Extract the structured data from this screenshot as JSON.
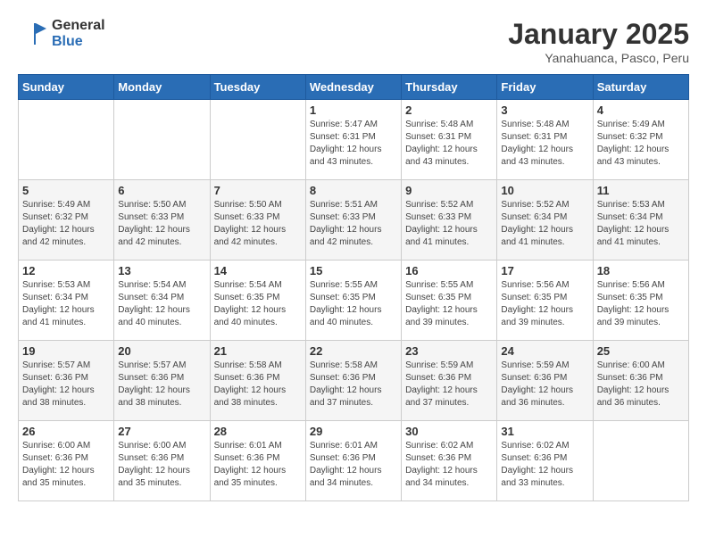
{
  "logo": {
    "general": "General",
    "blue": "Blue"
  },
  "header": {
    "title": "January 2025",
    "subtitle": "Yanahuanca, Pasco, Peru"
  },
  "weekdays": [
    "Sunday",
    "Monday",
    "Tuesday",
    "Wednesday",
    "Thursday",
    "Friday",
    "Saturday"
  ],
  "weeks": [
    [
      {
        "day": "",
        "sunrise": "",
        "sunset": "",
        "daylight": ""
      },
      {
        "day": "",
        "sunrise": "",
        "sunset": "",
        "daylight": ""
      },
      {
        "day": "",
        "sunrise": "",
        "sunset": "",
        "daylight": ""
      },
      {
        "day": "1",
        "sunrise": "Sunrise: 5:47 AM",
        "sunset": "Sunset: 6:31 PM",
        "daylight": "Daylight: 12 hours and 43 minutes."
      },
      {
        "day": "2",
        "sunrise": "Sunrise: 5:48 AM",
        "sunset": "Sunset: 6:31 PM",
        "daylight": "Daylight: 12 hours and 43 minutes."
      },
      {
        "day": "3",
        "sunrise": "Sunrise: 5:48 AM",
        "sunset": "Sunset: 6:31 PM",
        "daylight": "Daylight: 12 hours and 43 minutes."
      },
      {
        "day": "4",
        "sunrise": "Sunrise: 5:49 AM",
        "sunset": "Sunset: 6:32 PM",
        "daylight": "Daylight: 12 hours and 43 minutes."
      }
    ],
    [
      {
        "day": "5",
        "sunrise": "Sunrise: 5:49 AM",
        "sunset": "Sunset: 6:32 PM",
        "daylight": "Daylight: 12 hours and 42 minutes."
      },
      {
        "day": "6",
        "sunrise": "Sunrise: 5:50 AM",
        "sunset": "Sunset: 6:33 PM",
        "daylight": "Daylight: 12 hours and 42 minutes."
      },
      {
        "day": "7",
        "sunrise": "Sunrise: 5:50 AM",
        "sunset": "Sunset: 6:33 PM",
        "daylight": "Daylight: 12 hours and 42 minutes."
      },
      {
        "day": "8",
        "sunrise": "Sunrise: 5:51 AM",
        "sunset": "Sunset: 6:33 PM",
        "daylight": "Daylight: 12 hours and 42 minutes."
      },
      {
        "day": "9",
        "sunrise": "Sunrise: 5:52 AM",
        "sunset": "Sunset: 6:33 PM",
        "daylight": "Daylight: 12 hours and 41 minutes."
      },
      {
        "day": "10",
        "sunrise": "Sunrise: 5:52 AM",
        "sunset": "Sunset: 6:34 PM",
        "daylight": "Daylight: 12 hours and 41 minutes."
      },
      {
        "day": "11",
        "sunrise": "Sunrise: 5:53 AM",
        "sunset": "Sunset: 6:34 PM",
        "daylight": "Daylight: 12 hours and 41 minutes."
      }
    ],
    [
      {
        "day": "12",
        "sunrise": "Sunrise: 5:53 AM",
        "sunset": "Sunset: 6:34 PM",
        "daylight": "Daylight: 12 hours and 41 minutes."
      },
      {
        "day": "13",
        "sunrise": "Sunrise: 5:54 AM",
        "sunset": "Sunset: 6:34 PM",
        "daylight": "Daylight: 12 hours and 40 minutes."
      },
      {
        "day": "14",
        "sunrise": "Sunrise: 5:54 AM",
        "sunset": "Sunset: 6:35 PM",
        "daylight": "Daylight: 12 hours and 40 minutes."
      },
      {
        "day": "15",
        "sunrise": "Sunrise: 5:55 AM",
        "sunset": "Sunset: 6:35 PM",
        "daylight": "Daylight: 12 hours and 40 minutes."
      },
      {
        "day": "16",
        "sunrise": "Sunrise: 5:55 AM",
        "sunset": "Sunset: 6:35 PM",
        "daylight": "Daylight: 12 hours and 39 minutes."
      },
      {
        "day": "17",
        "sunrise": "Sunrise: 5:56 AM",
        "sunset": "Sunset: 6:35 PM",
        "daylight": "Daylight: 12 hours and 39 minutes."
      },
      {
        "day": "18",
        "sunrise": "Sunrise: 5:56 AM",
        "sunset": "Sunset: 6:35 PM",
        "daylight": "Daylight: 12 hours and 39 minutes."
      }
    ],
    [
      {
        "day": "19",
        "sunrise": "Sunrise: 5:57 AM",
        "sunset": "Sunset: 6:36 PM",
        "daylight": "Daylight: 12 hours and 38 minutes."
      },
      {
        "day": "20",
        "sunrise": "Sunrise: 5:57 AM",
        "sunset": "Sunset: 6:36 PM",
        "daylight": "Daylight: 12 hours and 38 minutes."
      },
      {
        "day": "21",
        "sunrise": "Sunrise: 5:58 AM",
        "sunset": "Sunset: 6:36 PM",
        "daylight": "Daylight: 12 hours and 38 minutes."
      },
      {
        "day": "22",
        "sunrise": "Sunrise: 5:58 AM",
        "sunset": "Sunset: 6:36 PM",
        "daylight": "Daylight: 12 hours and 37 minutes."
      },
      {
        "day": "23",
        "sunrise": "Sunrise: 5:59 AM",
        "sunset": "Sunset: 6:36 PM",
        "daylight": "Daylight: 12 hours and 37 minutes."
      },
      {
        "day": "24",
        "sunrise": "Sunrise: 5:59 AM",
        "sunset": "Sunset: 6:36 PM",
        "daylight": "Daylight: 12 hours and 36 minutes."
      },
      {
        "day": "25",
        "sunrise": "Sunrise: 6:00 AM",
        "sunset": "Sunset: 6:36 PM",
        "daylight": "Daylight: 12 hours and 36 minutes."
      }
    ],
    [
      {
        "day": "26",
        "sunrise": "Sunrise: 6:00 AM",
        "sunset": "Sunset: 6:36 PM",
        "daylight": "Daylight: 12 hours and 35 minutes."
      },
      {
        "day": "27",
        "sunrise": "Sunrise: 6:00 AM",
        "sunset": "Sunset: 6:36 PM",
        "daylight": "Daylight: 12 hours and 35 minutes."
      },
      {
        "day": "28",
        "sunrise": "Sunrise: 6:01 AM",
        "sunset": "Sunset: 6:36 PM",
        "daylight": "Daylight: 12 hours and 35 minutes."
      },
      {
        "day": "29",
        "sunrise": "Sunrise: 6:01 AM",
        "sunset": "Sunset: 6:36 PM",
        "daylight": "Daylight: 12 hours and 34 minutes."
      },
      {
        "day": "30",
        "sunrise": "Sunrise: 6:02 AM",
        "sunset": "Sunset: 6:36 PM",
        "daylight": "Daylight: 12 hours and 34 minutes."
      },
      {
        "day": "31",
        "sunrise": "Sunrise: 6:02 AM",
        "sunset": "Sunset: 6:36 PM",
        "daylight": "Daylight: 12 hours and 33 minutes."
      },
      {
        "day": "",
        "sunrise": "",
        "sunset": "",
        "daylight": ""
      }
    ]
  ]
}
